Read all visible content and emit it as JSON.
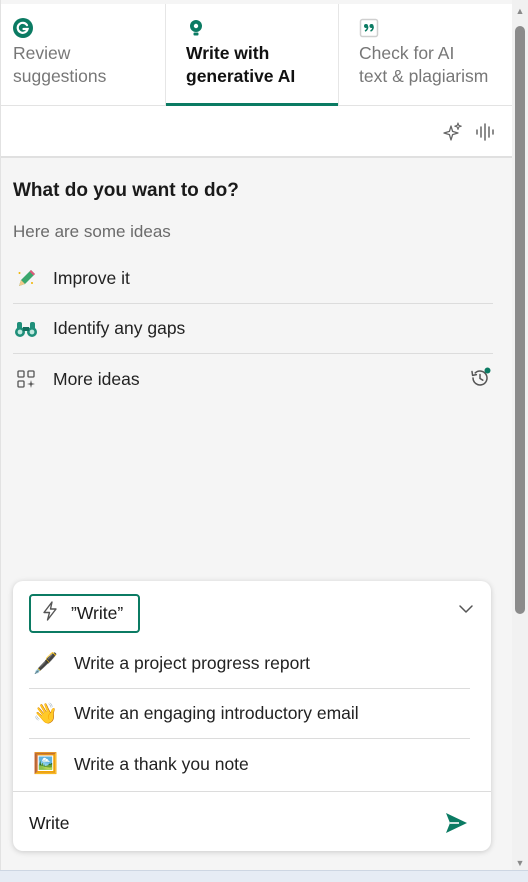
{
  "tabs": [
    {
      "label": "Review\nsuggestions",
      "icon": "grammarly-logo-icon",
      "active": false
    },
    {
      "label": "Write with\ngenerative AI",
      "icon": "lightbulb-icon",
      "active": true
    },
    {
      "label": "Check for AI\ntext & plagiarism",
      "icon": "quote-icon",
      "active": false
    }
  ],
  "toolbar": {
    "icons": [
      "sparkle-icon",
      "voice-waveform-icon"
    ]
  },
  "main": {
    "heading": "What do you want to do?",
    "subtext": "Here are some ideas",
    "ideas": [
      {
        "label": "Improve it",
        "icon": "pencil-icon"
      },
      {
        "label": "Identify any gaps",
        "icon": "binoculars-icon"
      },
      {
        "label": "More ideas",
        "icon": "grid-plus-icon"
      }
    ],
    "history_icon": "history-icon"
  },
  "prompt_card": {
    "chip_label": "”Write”",
    "chip_icon": "lightning-icon",
    "suggestions": [
      {
        "label": "Write a project progress report",
        "emoji": "🖋️"
      },
      {
        "label": "Write an engaging introductory email",
        "emoji": "👋"
      },
      {
        "label": "Write a thank you note",
        "emoji": "🖼️"
      }
    ],
    "input_value": "Write"
  },
  "colors": {
    "accent": "#0b7b63",
    "panel_bg": "#f5f5f5",
    "text": "#1a1a1a",
    "muted": "#6b6b6b"
  }
}
